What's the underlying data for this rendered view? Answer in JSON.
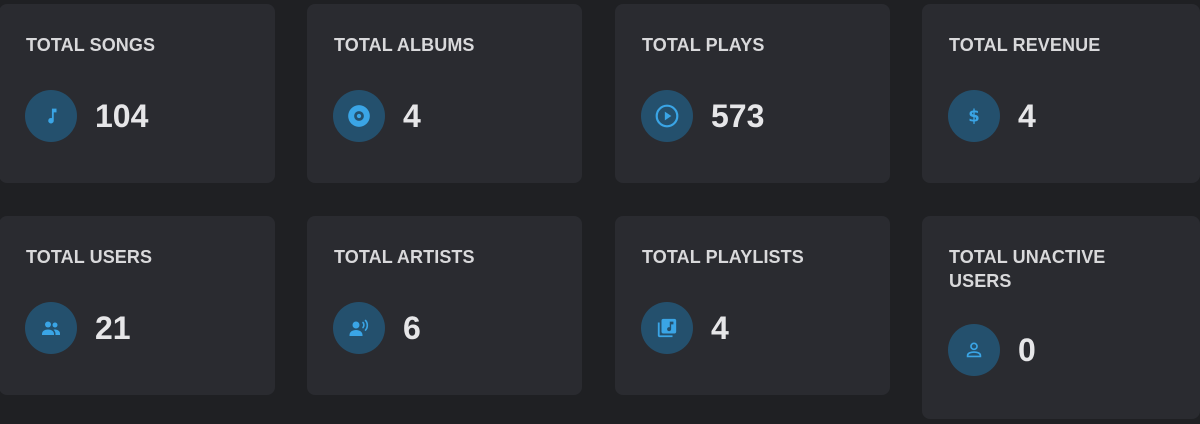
{
  "theme": {
    "background": "#1f2023",
    "card": "#2a2b30",
    "icon_bg": "#24506d",
    "icon_color": "#3aa5e6"
  },
  "stats": [
    {
      "label": "TOTAL SONGS",
      "value": "104",
      "icon": "music-note-icon"
    },
    {
      "label": "TOTAL ALBUMS",
      "value": "4",
      "icon": "album-disc-icon"
    },
    {
      "label": "TOTAL PLAYS",
      "value": "573",
      "icon": "play-circle-icon"
    },
    {
      "label": "TOTAL REVENUE",
      "value": "4",
      "icon": "dollar-icon"
    },
    {
      "label": "TOTAL USERS",
      "value": "21",
      "icon": "users-group-icon"
    },
    {
      "label": "TOTAL ARTISTS",
      "value": "6",
      "icon": "artist-voice-icon"
    },
    {
      "label": "TOTAL PLAYLISTS",
      "value": "4",
      "icon": "playlist-library-icon"
    },
    {
      "label": "TOTAL UNACTIVE\nUSERS",
      "value": "0",
      "icon": "user-outline-icon"
    }
  ]
}
